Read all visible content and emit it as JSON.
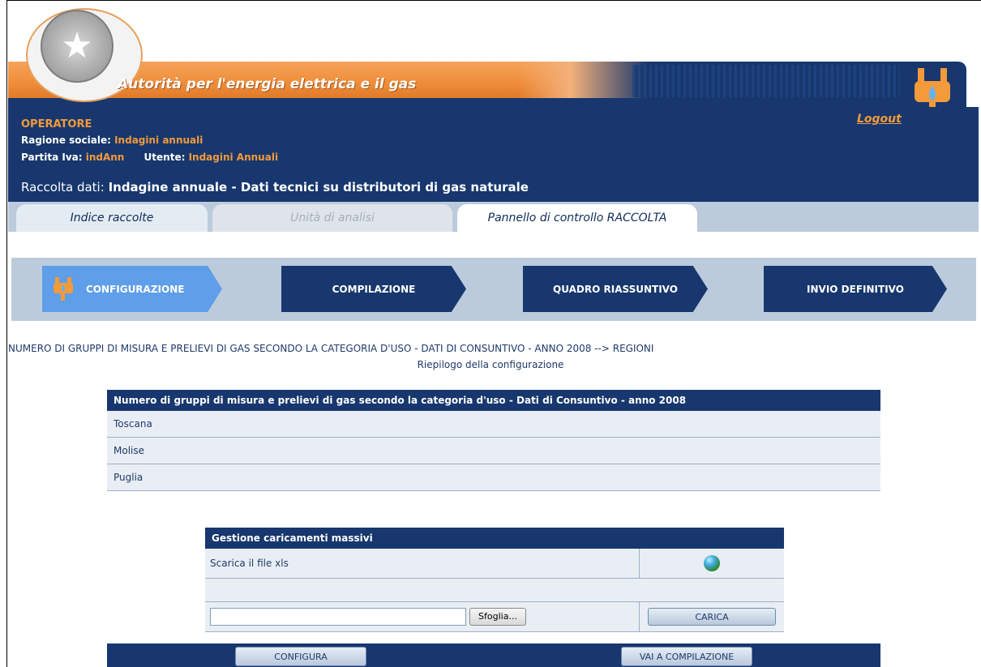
{
  "banner": {
    "title": "Autorità per l'energia elettrica e il gas"
  },
  "header": {
    "operatore_label": "OPERATORE",
    "ragione_label": "Ragione sociale:",
    "ragione_value": "Indagini annuali",
    "partita_label": "Partita Iva:",
    "partita_value": "indAnn",
    "utente_label": "Utente:",
    "utente_value": "Indagini Annuali",
    "raccolta_label": "Raccolta dati:",
    "raccolta_value": "Indagine annuale - Dati tecnici su distributori di gas naturale",
    "logout": "Logout"
  },
  "tabs": [
    {
      "label": "Indice raccolte",
      "state": "normal"
    },
    {
      "label": "Unità di analisi",
      "state": "disabled"
    },
    {
      "label": "Pannello di controllo RACCOLTA",
      "state": "active"
    }
  ],
  "steps": [
    {
      "label": "CONFIGURAZIONE",
      "active": true
    },
    {
      "label": "COMPILAZIONE",
      "active": false
    },
    {
      "label": "QUADRO RIASSUNTIVO",
      "active": false
    },
    {
      "label": "INVIO DEFINITIVO",
      "active": false
    }
  ],
  "section": {
    "title": "NUMERO DI GRUPPI DI MISURA E PRELIEVI DI GAS SECONDO LA CATEGORIA D'USO - DATI DI CONSUNTIVO - ANNO 2008 --> REGIONI",
    "subtitle": "Riepilogo della configurazione"
  },
  "regions_table": {
    "header": "Numero di gruppi di misura e prelievi di gas secondo la categoria d'uso - Dati di Consuntivo - anno 2008",
    "rows": [
      "Toscana",
      "Molise",
      "Puglia"
    ]
  },
  "bulk_table": {
    "header": "Gestione caricamenti massivi",
    "download_label": "Scarica il file xls",
    "file_value": "",
    "browse_label": "Sfoglia...",
    "upload_label": "CARICA"
  },
  "footer": {
    "configura_label": "CONFIGURA",
    "vai_label": "VAI A COMPILAZIONE"
  },
  "colors": {
    "navy": "#17376e",
    "orange": "#f39a3a",
    "active_step": "#5f9ee8",
    "tab_strip": "#bccbdc"
  },
  "icons": {
    "emblem": "republic-emblem-icon",
    "gas": "gas-pipe-icon",
    "download": "globe-download-icon"
  }
}
